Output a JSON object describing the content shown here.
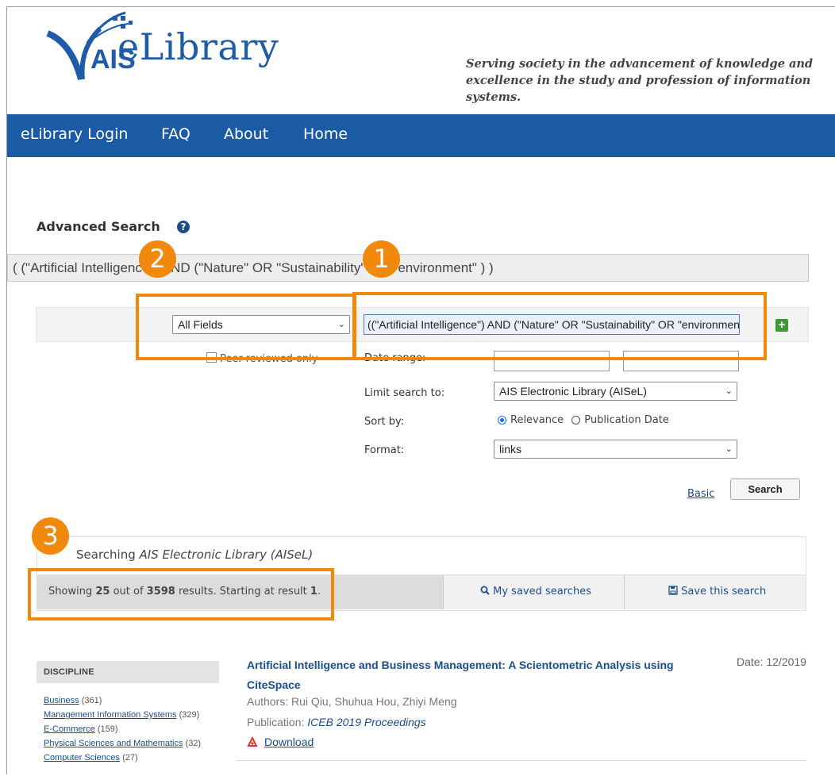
{
  "header": {
    "logo_text": "eLibrary",
    "logo_badge": "AIS",
    "tagline_line1": "Serving society in the advancement of knowledge and",
    "tagline_line2": "excellence in the study and profession of information systems."
  },
  "nav": {
    "items": [
      {
        "label": "eLibrary Login"
      },
      {
        "label": "FAQ"
      },
      {
        "label": "About"
      },
      {
        "label": "Home"
      }
    ]
  },
  "advanced_search": {
    "title": "Advanced Search",
    "help_icon": "?",
    "query_display": "( (\"Artificial Intelligence\") AND (\"Nature\" OR \"Sustainability\" OR \"environment\" ) )",
    "field_select": "All Fields",
    "query_value": "((\"Artificial Intelligence\") AND (\"Nature\" OR \"Sustainability\" OR \"environment\" ))",
    "add_icon": "+",
    "peer_reviewed_label": "Peer-reviewed only",
    "date_range_label": "Date range:",
    "limit_label": "Limit search to:",
    "limit_value": "AIS Electronic Library (AISeL)",
    "sort_label": "Sort by:",
    "sort_options": [
      {
        "label": "Relevance",
        "selected": true
      },
      {
        "label": "Publication Date",
        "selected": false
      }
    ],
    "format_label": "Format:",
    "format_value": "links",
    "basic_link": "Basic",
    "search_button": "Search"
  },
  "results": {
    "searching_prefix": "Searching",
    "searching_library": "AIS Electronic Library (AISeL)",
    "showing_prefix": "Showing",
    "showing_count": "25",
    "showing_mid": "out of",
    "showing_total": "3598",
    "showing_suffix": "results. Starting at result",
    "showing_start": "1",
    "saved_searches": "My saved searches",
    "save_search": "Save this search"
  },
  "facets": {
    "heading": "DISCIPLINE",
    "items": [
      {
        "label": "Business",
        "count": "(361)"
      },
      {
        "label": "Management Information Systems",
        "count": "(329)"
      },
      {
        "label": "E-Commerce",
        "count": "(159)"
      },
      {
        "label": "Physical Sciences and Mathematics",
        "count": "(32)"
      },
      {
        "label": "Computer Sciences",
        "count": "(27)"
      }
    ]
  },
  "result_item": {
    "title": "Artificial Intelligence and Business Management: A Scientometric Analysis using CiteSpace",
    "date": "Date: 12/2019",
    "authors": "Authors: Rui Qiu, Shuhua Hou, Zhiyi Meng",
    "publication_label": "Publication:",
    "publication": "ICEB 2019 Proceedings",
    "download": "Download"
  },
  "annotations": [
    {
      "number": "1"
    },
    {
      "number": "2"
    },
    {
      "number": "3"
    }
  ],
  "colors": {
    "nav_bg": "#1b5aa5",
    "link": "#1b4e8c",
    "annotation": "#f0890c"
  }
}
